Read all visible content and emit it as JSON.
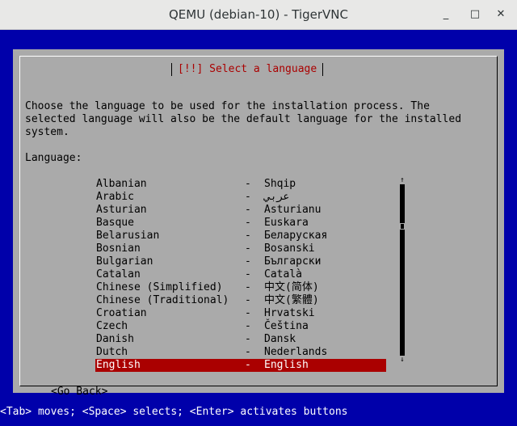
{
  "window": {
    "title": "QEMU (debian-10) - TigerVNC",
    "minimize_glyph": "_",
    "maximize_glyph": "□",
    "close_glyph": "✕"
  },
  "dialog": {
    "title": "[!!] Select a language",
    "description_lines": [
      "Choose the language to be used for the installation process. The",
      "selected language will also be the default language for the installed",
      "system."
    ],
    "field_label": "Language:",
    "languages": [
      {
        "name": "Albanian",
        "native": "Shqip"
      },
      {
        "name": "Arabic",
        "native": "عربي"
      },
      {
        "name": "Asturian",
        "native": "Asturianu"
      },
      {
        "name": "Basque",
        "native": "Euskara"
      },
      {
        "name": "Belarusian",
        "native": "Беларуская"
      },
      {
        "name": "Bosnian",
        "native": "Bosanski"
      },
      {
        "name": "Bulgarian",
        "native": "Български"
      },
      {
        "name": "Catalan",
        "native": "Català"
      },
      {
        "name": "Chinese (Simplified)",
        "native": "中文(简体)"
      },
      {
        "name": "Chinese (Traditional)",
        "native": "中文(繁體)"
      },
      {
        "name": "Croatian",
        "native": "Hrvatski"
      },
      {
        "name": "Czech",
        "native": "Čeština"
      },
      {
        "name": "Danish",
        "native": "Dansk"
      },
      {
        "name": "Dutch",
        "native": "Nederlands"
      },
      {
        "name": "English",
        "native": "English",
        "selected": true
      }
    ],
    "separator": "-",
    "scroll_up_glyph": "↑",
    "scroll_down_glyph": "↓",
    "go_back_label": "<Go Back>"
  },
  "statusbar": {
    "text": "<Tab> moves; <Space> selects; <Enter> activates buttons"
  },
  "colors": {
    "background": "#0000aa",
    "dialog": "#aaaaaa",
    "title_text": "#aa0000",
    "selection": "#aa0000"
  }
}
